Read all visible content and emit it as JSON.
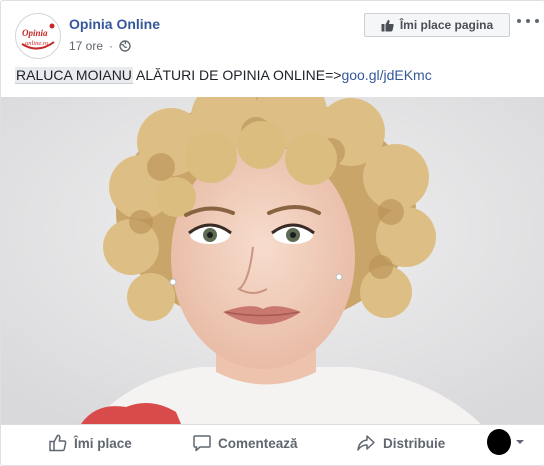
{
  "header": {
    "page_name": "Opinia Online",
    "timestamp": "17 ore",
    "like_page_label": "Îmi place pagina",
    "avatar_text_line1": "Opinia",
    "avatar_text_line2": "online.ro"
  },
  "post": {
    "mention": "RALUCA MOIANU",
    "text": " ALĂTURI DE OPINIA ONLINE=>",
    "link": "goo.gl/jdEKmc"
  },
  "actions": {
    "like_label": "Îmi place",
    "comment_label": "Comentează",
    "share_label": "Distribuie"
  },
  "colors": {
    "link": "#365899",
    "action_text": "#606770",
    "border": "#dddfe2"
  }
}
